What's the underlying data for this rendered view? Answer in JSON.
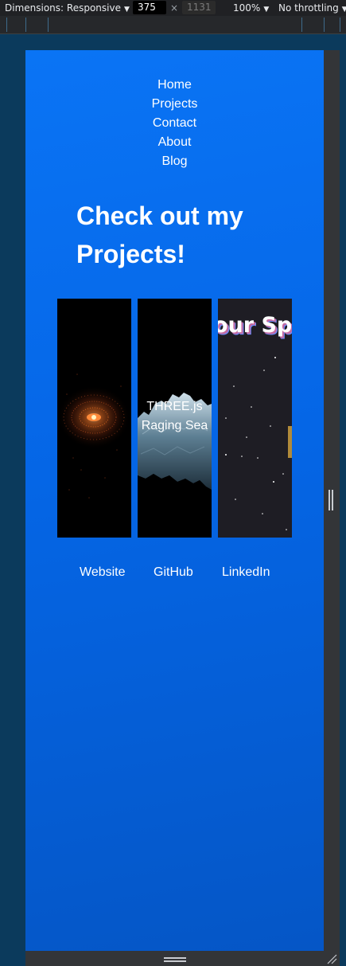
{
  "devtools": {
    "dimensions_label": "Dimensions: Responsive",
    "width_value": "375",
    "height_value": "1131",
    "times_sign": "×",
    "zoom": "100%",
    "throttling": "No throttling"
  },
  "nav": {
    "items": [
      {
        "label": "Home"
      },
      {
        "label": "Projects"
      },
      {
        "label": "Contact"
      },
      {
        "label": "About"
      },
      {
        "label": "Blog"
      }
    ]
  },
  "main": {
    "heading": "Check out my Projects!",
    "projects": [
      {
        "label": "",
        "icon": "spiral-galaxy-image"
      },
      {
        "label": "THREE.js Raging Sea",
        "icon": "raging-sea-image"
      },
      {
        "label": "",
        "title_text": "our Sp",
        "icon": "starfield-image"
      }
    ]
  },
  "footer_links": [
    {
      "label": "Website"
    },
    {
      "label": "GitHub"
    },
    {
      "label": "LinkedIn"
    }
  ],
  "colors": {
    "page_gradient_top": "#0a74f5",
    "page_gradient_bottom": "#0556c6",
    "devtools_bg": "#202124"
  }
}
